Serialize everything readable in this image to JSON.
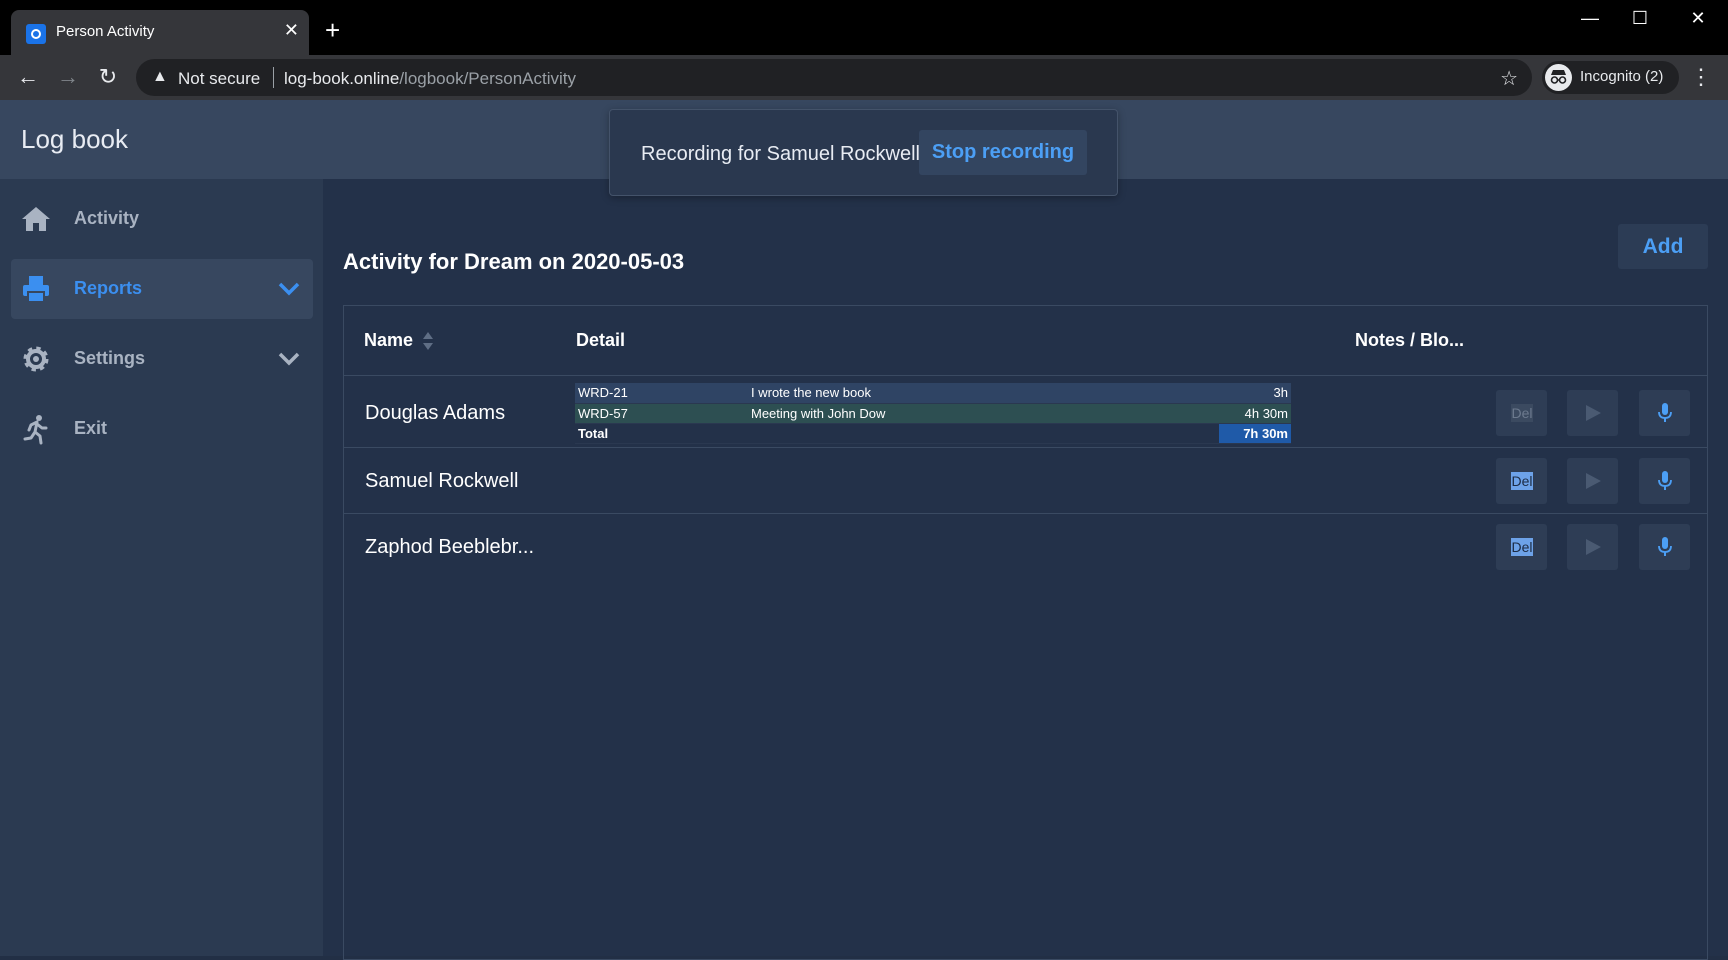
{
  "browser": {
    "tab_title": "Person Activity",
    "tab_close": "✕",
    "new_tab": "+",
    "window_controls": {
      "minimize": "—",
      "maximize": "☐",
      "close": "✕"
    },
    "nav": {
      "back": "←",
      "forward": "→",
      "reload": "↻"
    },
    "security_label": "Not secure",
    "url_host": "log-book.online",
    "url_path": "/logbook/PersonActivity",
    "star": "☆",
    "incognito_label": "Incognito (2)",
    "menu": "⋮"
  },
  "app": {
    "title": "Log book"
  },
  "sidebar": {
    "items": [
      {
        "label": "Activity",
        "icon": "home-icon",
        "active": false
      },
      {
        "label": "Reports",
        "icon": "printer-icon",
        "active": true,
        "expandable": true
      },
      {
        "label": "Settings",
        "icon": "gear-icon",
        "active": false,
        "expandable": true
      },
      {
        "label": "Exit",
        "icon": "running-person-icon",
        "active": false
      }
    ]
  },
  "main": {
    "title": "Activity for Dream on 2020-05-03",
    "add_label": "Add",
    "columns": {
      "name": "Name",
      "detail": "Detail",
      "notes": "Notes / Blo..."
    },
    "rows": [
      {
        "name": "Douglas Adams",
        "details": [
          {
            "key": "WRD-21",
            "desc": "I wrote the new book",
            "time": "3h"
          },
          {
            "key": "WRD-57",
            "desc": "Meeting with John Dow",
            "time": "4h 30m"
          }
        ],
        "total_label": "Total",
        "total": "7h 30m",
        "del_label": "Del",
        "del_enabled": false
      },
      {
        "name": "Samuel Rockwell",
        "del_label": "Del",
        "del_enabled": true
      },
      {
        "name": "Zaphod Beeblebr...",
        "del_label": "Del",
        "del_enabled": true
      }
    ]
  },
  "toast": {
    "message": "Recording for Samuel Rockwell",
    "action_label": "Stop recording"
  },
  "colors": {
    "accent": "#3b8ff0",
    "background": "#233149",
    "header": "#37475f"
  }
}
